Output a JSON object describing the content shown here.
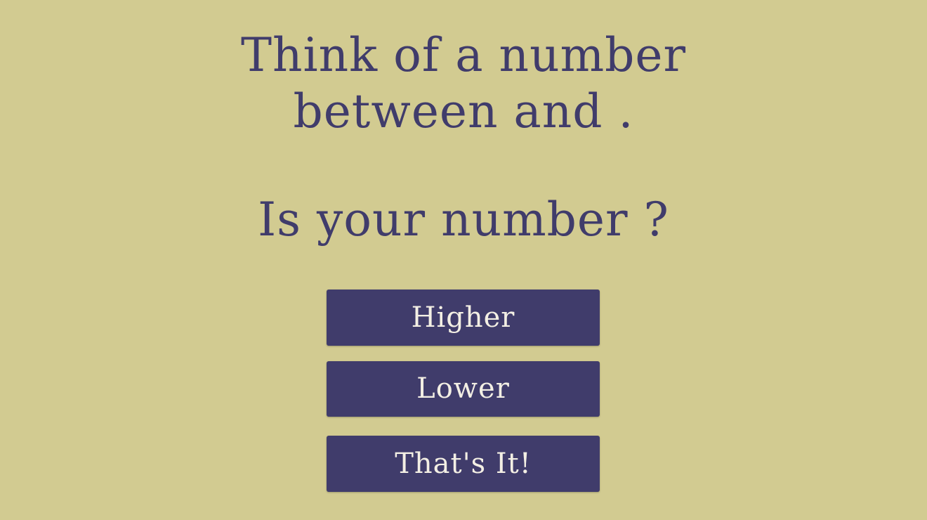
{
  "prompt": {
    "line1": "Think of a number",
    "line2": "between and .",
    "question": "Is your number ?"
  },
  "buttons": {
    "higher": "Higher",
    "lower": "Lower",
    "thats_it": "That's It!"
  },
  "colors": {
    "background": "#d2cb91",
    "text": "#403c6b",
    "button_bg": "#403c6b",
    "button_text": "#f3efe4"
  }
}
